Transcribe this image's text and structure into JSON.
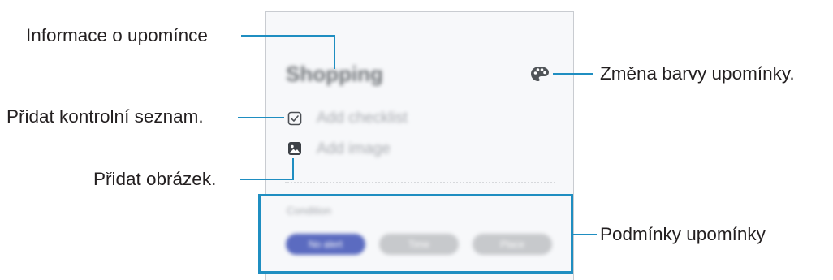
{
  "callouts": {
    "reminder_info": "Informace o upomínce",
    "add_checklist": "Přidat kontrolní seznam.",
    "add_image": "Přidat obrázek.",
    "change_color": "Změna barvy upomínky.",
    "conditions": "Podmínky upomínky"
  },
  "card": {
    "title": "Shopping",
    "add_checklist_label": "Add checklist",
    "add_image_label": "Add image",
    "condition_label": "Condition",
    "condition_options": [
      "No alert",
      "Time",
      "Place"
    ]
  },
  "colors": {
    "accent_line": "#1f8ec1",
    "pill_selected": "#5b6bc0",
    "pill_unselected": "#c7c9cc"
  },
  "icons": [
    "palette-icon",
    "checklist-icon",
    "image-icon"
  ]
}
